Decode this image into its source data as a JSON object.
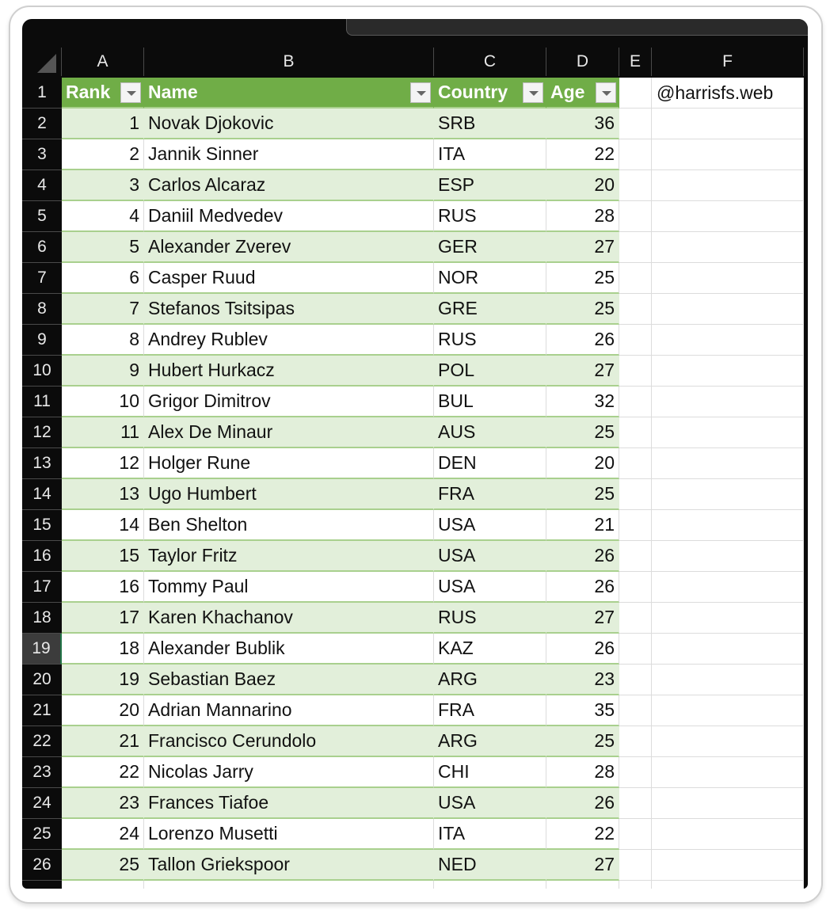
{
  "columns": [
    "A",
    "B",
    "C",
    "D",
    "E",
    "F"
  ],
  "header": {
    "rank": "Rank",
    "name": "Name",
    "country": "Country",
    "age": "Age"
  },
  "watermark_cell": "@harrisfs.web",
  "selected_row": 19,
  "colors": {
    "header_green": "#70ad47",
    "band_green": "#e2efda",
    "border_green": "#a9d08e"
  },
  "rows": [
    {
      "rank": "1",
      "name": "Novak Djokovic",
      "country": "SRB",
      "age": "36"
    },
    {
      "rank": "2",
      "name": "Jannik Sinner",
      "country": "ITA",
      "age": "22"
    },
    {
      "rank": "3",
      "name": "Carlos Alcaraz",
      "country": "ESP",
      "age": "20"
    },
    {
      "rank": "4",
      "name": "Daniil Medvedev",
      "country": "RUS",
      "age": "28"
    },
    {
      "rank": "5",
      "name": "Alexander Zverev",
      "country": "GER",
      "age": "27"
    },
    {
      "rank": "6",
      "name": "Casper Ruud",
      "country": "NOR",
      "age": "25"
    },
    {
      "rank": "7",
      "name": "Stefanos Tsitsipas",
      "country": "GRE",
      "age": "25"
    },
    {
      "rank": "8",
      "name": "Andrey Rublev",
      "country": "RUS",
      "age": "26"
    },
    {
      "rank": "9",
      "name": "Hubert Hurkacz",
      "country": "POL",
      "age": "27"
    },
    {
      "rank": "10",
      "name": "Grigor Dimitrov",
      "country": "BUL",
      "age": "32"
    },
    {
      "rank": "11",
      "name": "Alex De Minaur",
      "country": "AUS",
      "age": "25"
    },
    {
      "rank": "12",
      "name": "Holger Rune",
      "country": "DEN",
      "age": "20"
    },
    {
      "rank": "13",
      "name": "Ugo Humbert",
      "country": "FRA",
      "age": "25"
    },
    {
      "rank": "14",
      "name": "Ben Shelton",
      "country": "USA",
      "age": "21"
    },
    {
      "rank": "15",
      "name": "Taylor Fritz",
      "country": "USA",
      "age": "26"
    },
    {
      "rank": "16",
      "name": "Tommy Paul",
      "country": "USA",
      "age": "26"
    },
    {
      "rank": "17",
      "name": "Karen Khachanov",
      "country": "RUS",
      "age": "27"
    },
    {
      "rank": "18",
      "name": "Alexander Bublik",
      "country": "KAZ",
      "age": "26"
    },
    {
      "rank": "19",
      "name": "Sebastian Baez",
      "country": "ARG",
      "age": "23"
    },
    {
      "rank": "20",
      "name": "Adrian Mannarino",
      "country": "FRA",
      "age": "35"
    },
    {
      "rank": "21",
      "name": "Francisco Cerundolo",
      "country": "ARG",
      "age": "25"
    },
    {
      "rank": "22",
      "name": "Nicolas Jarry",
      "country": "CHI",
      "age": "28"
    },
    {
      "rank": "23",
      "name": "Frances Tiafoe",
      "country": "USA",
      "age": "26"
    },
    {
      "rank": "24",
      "name": "Lorenzo Musetti",
      "country": "ITA",
      "age": "22"
    },
    {
      "rank": "25",
      "name": "Tallon Griekspoor",
      "country": "NED",
      "age": "27"
    }
  ]
}
